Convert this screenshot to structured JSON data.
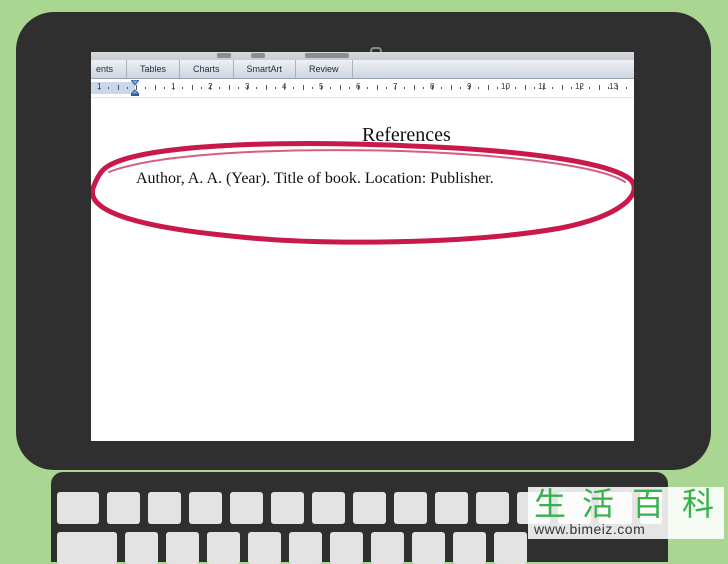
{
  "ribbon": {
    "tabs": [
      {
        "label": "ents"
      },
      {
        "label": "Tables"
      },
      {
        "label": "Charts"
      },
      {
        "label": "SmartArt"
      },
      {
        "label": "Review"
      }
    ]
  },
  "ruler": {
    "labels": [
      "1",
      "1",
      "2",
      "3",
      "4",
      "5",
      "6",
      "7",
      "8",
      "9",
      "10",
      "11",
      "12",
      "13"
    ]
  },
  "document": {
    "heading": "References",
    "entry": "Author, A. A. (Year). Title of book. Location: Publisher."
  },
  "annotation": {
    "color": "#c8194a"
  },
  "watermark": {
    "chars": [
      "生",
      "活",
      "百",
      "科"
    ],
    "url": "www.bimeiz.com",
    "color": "#36b24a"
  },
  "colors": {
    "background": "#a9d690",
    "device": "#2f2f2f",
    "key": "#e3e3e3"
  }
}
